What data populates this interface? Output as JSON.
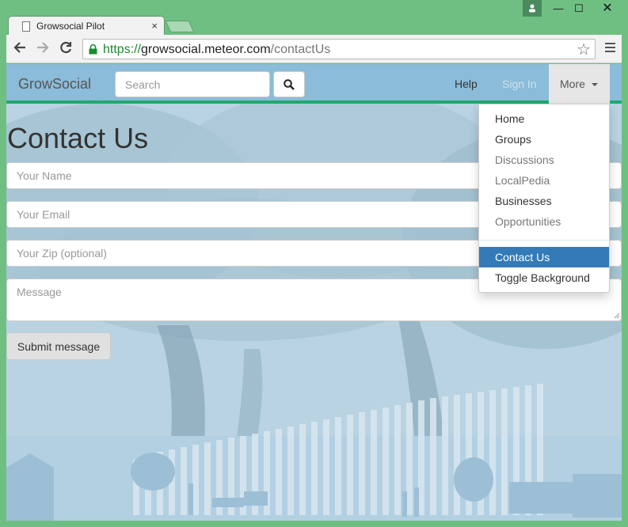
{
  "browser": {
    "tab_title": "Growsocial Pilot",
    "tab_close": "×",
    "url_scheme": "https://",
    "url_host": "growsocial.meteor.com",
    "url_path": "/contactUs",
    "back_glyph": "🡐",
    "forward_glyph": "🡒",
    "reload_glyph": "↻",
    "star_glyph": "☆",
    "min_glyph": "—",
    "max_glyph": "☐",
    "close_glyph": "✕",
    "profile_glyph": "👤"
  },
  "navbar": {
    "brand": "GrowSocial",
    "search_placeholder": "Search",
    "help": "Help",
    "sign_in": "Sign In",
    "more": "More"
  },
  "page": {
    "title": "Contact Us",
    "name_placeholder": "Your Name",
    "email_placeholder": "Your Email",
    "zip_placeholder": "Your Zip (optional)",
    "message_placeholder": "Message",
    "submit_label": "Submit message"
  },
  "dropdown": {
    "items": [
      {
        "label": "Home"
      },
      {
        "label": "Groups"
      },
      {
        "label": "Discussions"
      },
      {
        "label": "LocalPedia"
      },
      {
        "label": "Businesses"
      },
      {
        "label": "Opportunities"
      },
      {
        "label": "Contact Us"
      },
      {
        "label": "Toggle Background"
      }
    ]
  },
  "colors": {
    "window_frame": "#6fbf83",
    "navbar": "#8bbcd9",
    "navbar_border": "#1eaa6c",
    "active_item": "#337ab7"
  }
}
